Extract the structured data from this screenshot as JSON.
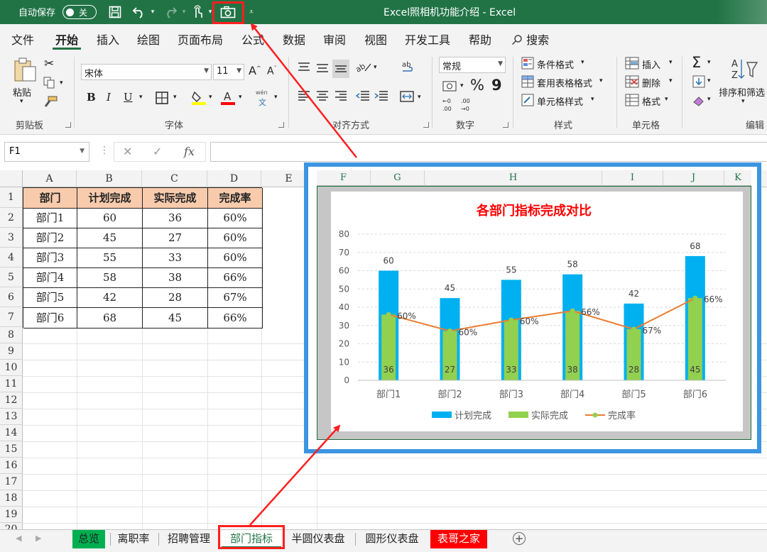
{
  "titlebar": {
    "autosave_label": "自动保存",
    "autosave_state": "关",
    "doc_title": "Excel照相机功能介绍  -  Excel",
    "bg_color": "#217346"
  },
  "quick_access": [
    {
      "icon": "save-icon"
    },
    {
      "icon": "undo-icon"
    },
    {
      "icon": "redo-icon"
    },
    {
      "icon": "touch-mode-icon"
    },
    {
      "icon": "camera-icon"
    },
    {
      "icon": "customize-qat-icon"
    }
  ],
  "menu_tabs": [
    "文件",
    "开始",
    "插入",
    "绘图",
    "页面布局",
    "公式",
    "数据",
    "审阅",
    "视图",
    "开发工具",
    "帮助"
  ],
  "active_menu_tab": "开始",
  "search": {
    "label": "搜索"
  },
  "ribbon": {
    "clipboard": {
      "paste": "粘贴",
      "group": "剪贴板"
    },
    "font": {
      "name": "宋体",
      "size": "11",
      "bold": "B",
      "italic": "I",
      "underline": "U",
      "grow": "A",
      "shrink": "A",
      "wen": "wén",
      "wen_char": "文",
      "group": "字体"
    },
    "alignment": {
      "group": "对齐方式"
    },
    "number": {
      "format": "常规",
      "percent": "%",
      "comma": "9",
      "group": "数字"
    },
    "styles": {
      "cond_format": "条件格式",
      "table_format": "套用表格格式",
      "cell_style": "单元格样式",
      "group": "样式"
    },
    "cells": {
      "insert": "插入",
      "delete": "删除",
      "format": "格式",
      "group": "单元格"
    },
    "editing": {
      "sort_filter": "排序和筛选",
      "group": "编辑"
    }
  },
  "formula_bar": {
    "name_box": "F1",
    "fx": "fx",
    "value": ""
  },
  "columns": [
    "A",
    "B",
    "C",
    "D",
    "E"
  ],
  "picture_columns": [
    "F",
    "G",
    "H",
    "I",
    "J",
    "K"
  ],
  "rows": [
    "1",
    "2",
    "3",
    "4",
    "5",
    "6",
    "7",
    "8",
    "9",
    "10",
    "11",
    "12",
    "13",
    "14",
    "15",
    "16",
    "17",
    "18",
    "19",
    "20"
  ],
  "table": {
    "headers": [
      "部门",
      "计划完成",
      "实际完成",
      "完成率"
    ],
    "rows": [
      [
        "部门1",
        "60",
        "36",
        "60%"
      ],
      [
        "部门2",
        "45",
        "27",
        "60%"
      ],
      [
        "部门3",
        "55",
        "33",
        "60%"
      ],
      [
        "部门4",
        "58",
        "38",
        "66%"
      ],
      [
        "部门5",
        "42",
        "28",
        "67%"
      ],
      [
        "部门6",
        "68",
        "45",
        "66%"
      ]
    ]
  },
  "chart_data": {
    "type": "bar",
    "title": "各部门指标完成对比",
    "categories": [
      "部门1",
      "部门2",
      "部门3",
      "部门4",
      "部门5",
      "部门6"
    ],
    "series": [
      {
        "name": "计划完成",
        "type": "bar",
        "values": [
          60,
          45,
          55,
          58,
          42,
          68
        ],
        "color": "#00b0f0"
      },
      {
        "name": "实际完成",
        "type": "bar",
        "values": [
          36,
          27,
          33,
          38,
          28,
          45
        ],
        "color": "#92d050"
      },
      {
        "name": "完成率",
        "type": "line",
        "values": [
          60,
          60,
          60,
          66,
          67,
          66
        ],
        "labels": [
          "60%",
          "60%",
          "60%",
          "66%",
          "67%",
          "66%"
        ],
        "color": "#ed7d31"
      }
    ],
    "ylim": [
      0,
      80
    ],
    "yticks": [
      "0",
      "10",
      "20",
      "30",
      "40",
      "50",
      "60",
      "70",
      "80"
    ],
    "grid": true,
    "legend": "bottom",
    "title_color": "#ff0000"
  },
  "sheet_tabs": [
    {
      "label": "总览",
      "style": "green"
    },
    {
      "label": "离职率",
      "style": "normal"
    },
    {
      "label": "招聘管理",
      "style": "normal"
    },
    {
      "label": "部门指标",
      "style": "active"
    },
    {
      "label": "半圆仪表盘",
      "style": "normal"
    },
    {
      "label": "圆形仪表盘",
      "style": "normal"
    },
    {
      "label": "表哥之家",
      "style": "red"
    }
  ],
  "annotation_color": "#ff1f1f"
}
